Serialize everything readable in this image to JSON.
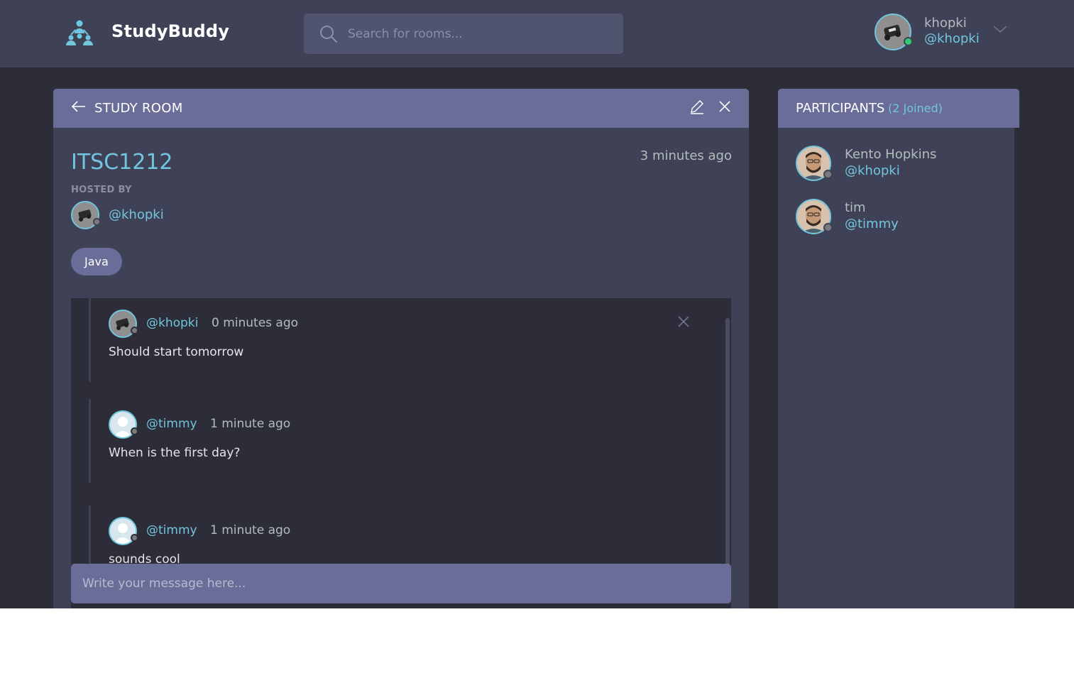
{
  "brand": {
    "name": "StudyBuddy"
  },
  "search": {
    "placeholder": "Search for rooms..."
  },
  "user": {
    "name": "khopki",
    "handle": "@khopki",
    "status": "online"
  },
  "room": {
    "header_title": "STUDY ROOM",
    "name": "ITSC1212",
    "created": "3 minutes ago",
    "hosted_by_label": "HOSTED BY",
    "host_handle": "@khopki",
    "topic": "Java"
  },
  "messages": [
    {
      "handle": "@khopki",
      "time": "0 minutes ago",
      "body": "Should start tomorrow",
      "deletable": true
    },
    {
      "handle": "@timmy",
      "time": "1 minute ago",
      "body": "When is the first day?"
    },
    {
      "handle": "@timmy",
      "time": "1 minute ago",
      "body": "sounds cool"
    }
  ],
  "composer": {
    "placeholder": "Write your message here..."
  },
  "participants": {
    "title": "PARTICIPANTS",
    "count_label": "(2 Joined)",
    "items": [
      {
        "name": "Kento Hopkins",
        "handle": "@khopki"
      },
      {
        "name": "tim",
        "handle": "@timmy"
      }
    ]
  },
  "colors": {
    "accent": "#71c6dd",
    "header": "#696d97",
    "panel": "#3f4156",
    "background": "#2d2d39",
    "online": "#2ecc71"
  }
}
